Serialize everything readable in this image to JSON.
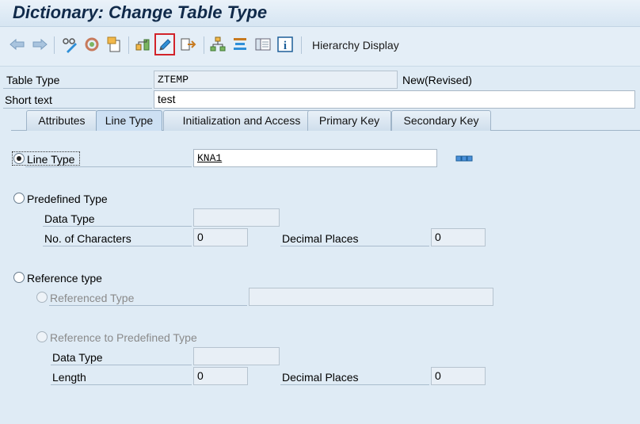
{
  "window": {
    "title": "Dictionary: Change Table Type"
  },
  "toolbar": {
    "buttons": [
      {
        "icon": "back-arrow-icon"
      },
      {
        "icon": "forward-arrow-icon"
      },
      {
        "icon": "display-change-icon"
      },
      {
        "icon": "active-inactive-icon"
      },
      {
        "icon": "other-object-icon"
      },
      {
        "icon": "check-icon"
      },
      {
        "icon": "pencil-icon",
        "selected": true
      },
      {
        "icon": "activate-icon"
      },
      {
        "icon": "where-used-icon"
      },
      {
        "icon": "object-list-icon"
      },
      {
        "icon": "display-object-list-icon"
      },
      {
        "icon": "info-icon"
      }
    ],
    "hierarchy_display": "Hierarchy Display"
  },
  "header": {
    "table_type_label": "Table Type",
    "table_type_value": "ZTEMP",
    "status": "New(Revised)",
    "short_text_label": "Short text",
    "short_text_value": "test"
  },
  "tabs": [
    {
      "label": "Attributes",
      "active": false
    },
    {
      "label": "Line Type",
      "active": true
    },
    {
      "label": "Initialization and Access",
      "active": false
    },
    {
      "label": "Primary Key",
      "active": false
    },
    {
      "label": "Secondary Key",
      "active": false
    }
  ],
  "line_type": {
    "line_type_label": "Line Type",
    "line_type_value": "KNA1",
    "predefined_type_label": "Predefined Type",
    "data_type_label": "Data Type",
    "no_chars_label": "No. of Characters",
    "no_chars_value": "0",
    "decimal_places_label": "Decimal Places",
    "decimal_places_value": "0",
    "reference_type_label": "Reference type",
    "referenced_type_label": "Referenced Type",
    "ref_predefined_label": "Reference to Predefined Type",
    "ref_data_type_label": "Data Type",
    "length_label": "Length",
    "length_value": "0",
    "ref_decimal_places_label": "Decimal Places",
    "ref_decimal_places_value": "0"
  },
  "colors": {
    "selected_border": "#d2232a",
    "background": "#dfebf5"
  }
}
